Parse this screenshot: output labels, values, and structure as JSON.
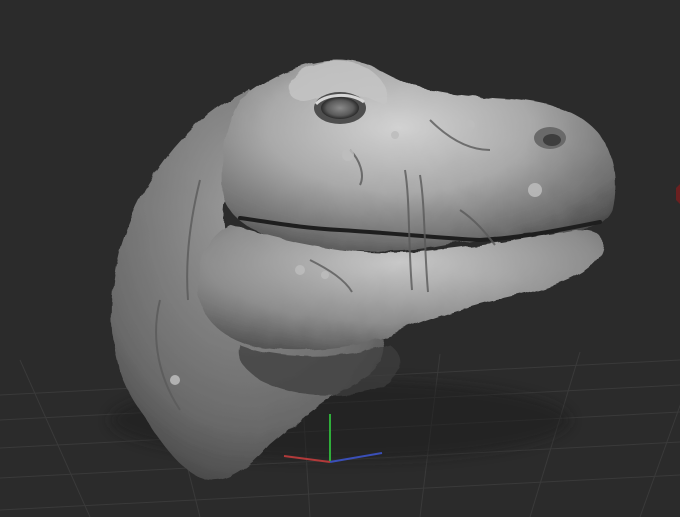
{
  "viewport": {
    "background_color": "#2b2b2b",
    "grid_color": "#3a3a3a",
    "model_name": "dinosaur-head-sculpt",
    "model_color": "#a8a8a8",
    "axis_colors": {
      "x": "#b23a3a",
      "y": "#2fae3a",
      "z": "#3a4fb8"
    },
    "edge_marker_color": "#6a2020"
  }
}
